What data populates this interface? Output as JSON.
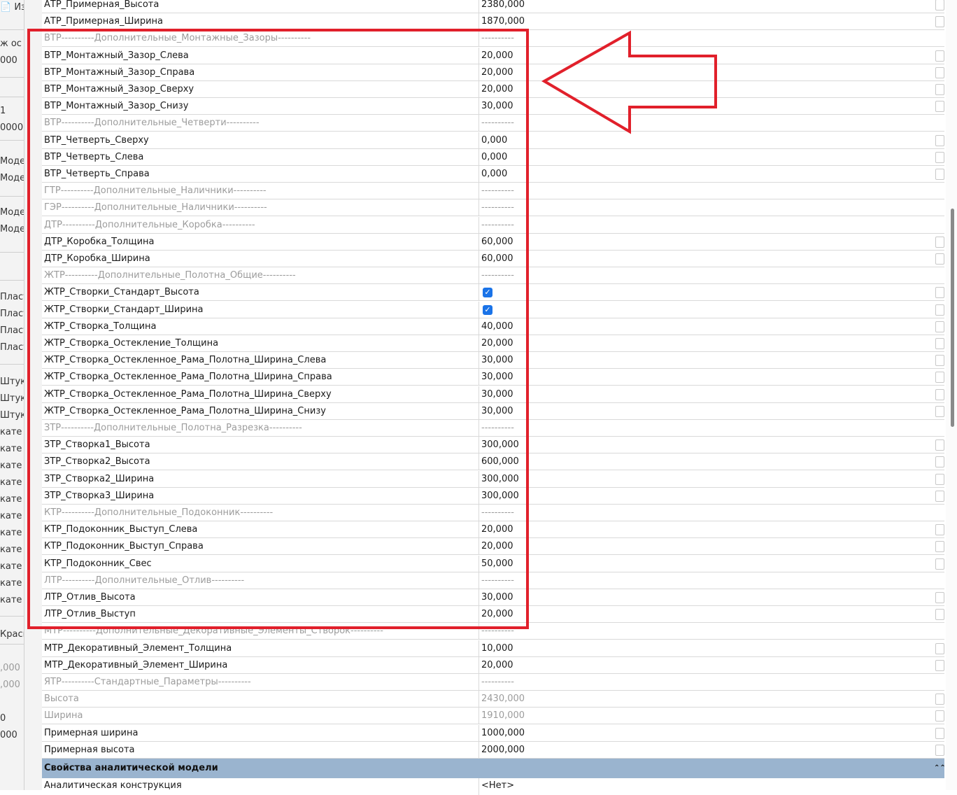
{
  "left_panel_fragments": [
    {
      "text": "📄 Из",
      "dim": false
    },
    {
      "text": "ж ос",
      "dim": false
    },
    {
      "text": "000",
      "dim": false
    },
    {
      "text": "1",
      "dim": false
    },
    {
      "text": "0000",
      "dim": false
    },
    {
      "text": "Моде",
      "dim": false
    },
    {
      "text": "Моде",
      "dim": false
    },
    {
      "text": "Моде",
      "dim": false
    },
    {
      "text": "Моде",
      "dim": false
    },
    {
      "text": "Пласт",
      "dim": false
    },
    {
      "text": "Пласт",
      "dim": false
    },
    {
      "text": "Пласт",
      "dim": false
    },
    {
      "text": "Пласт",
      "dim": false
    },
    {
      "text": "Штука",
      "dim": false
    },
    {
      "text": "Штука",
      "dim": false
    },
    {
      "text": "Штука",
      "dim": false
    },
    {
      "text": "кате",
      "dim": false
    },
    {
      "text": "кате",
      "dim": false
    },
    {
      "text": "кате",
      "dim": false
    },
    {
      "text": "кате",
      "dim": false
    },
    {
      "text": "кате",
      "dim": false
    },
    {
      "text": "кате",
      "dim": false
    },
    {
      "text": "кате",
      "dim": false
    },
    {
      "text": "кате",
      "dim": false
    },
    {
      "text": "кате",
      "dim": false
    },
    {
      "text": "кате",
      "dim": false
    },
    {
      "text": "кате",
      "dim": false
    },
    {
      "text": "Краск",
      "dim": false
    },
    {
      "text": ",000",
      "dim": true
    },
    {
      "text": ",000",
      "dim": true
    },
    {
      "text": "0",
      "dim": false
    },
    {
      "text": "000",
      "dim": false
    }
  ],
  "rows": [
    {
      "name": "АТР_Примерная_Высота",
      "value": "2380,000",
      "kind": "normal"
    },
    {
      "name": "АТР_Примерная_Ширина",
      "value": "1870,000",
      "kind": "normal"
    },
    {
      "name": "ВТР----------Дополнительные_Монтажные_Зазоры----------",
      "value": "----------",
      "kind": "group"
    },
    {
      "name": "ВТР_Монтажный_Зазор_Слева",
      "value": "20,000",
      "kind": "normal"
    },
    {
      "name": "ВТР_Монтажный_Зазор_Справа",
      "value": "20,000",
      "kind": "normal"
    },
    {
      "name": "ВТР_Монтажный_Зазор_Сверху",
      "value": "20,000",
      "kind": "normal"
    },
    {
      "name": "ВТР_Монтажный_Зазор_Снизу",
      "value": "30,000",
      "kind": "normal"
    },
    {
      "name": "ВТР----------Дополнительные_Четверти----------",
      "value": "----------",
      "kind": "group"
    },
    {
      "name": "ВТР_Четверть_Сверху",
      "value": "0,000",
      "kind": "normal"
    },
    {
      "name": "ВТР_Четверть_Слева",
      "value": "0,000",
      "kind": "normal"
    },
    {
      "name": "ВТР_Четверть_Справа",
      "value": "0,000",
      "kind": "normal"
    },
    {
      "name": "ГТР----------Дополнительные_Наличники----------",
      "value": "----------",
      "kind": "group"
    },
    {
      "name": "ГЭР----------Дополнительные_Наличники----------",
      "value": "----------",
      "kind": "group"
    },
    {
      "name": "ДТР----------Дополнительные_Коробка----------",
      "value": "----------",
      "kind": "group"
    },
    {
      "name": "ДТР_Коробка_Толщина",
      "value": "60,000",
      "kind": "normal"
    },
    {
      "name": "ДТР_Коробка_Ширина",
      "value": "60,000",
      "kind": "normal"
    },
    {
      "name": "ЖТР----------Дополнительные_Полотна_Общие----------",
      "value": "----------",
      "kind": "group"
    },
    {
      "name": "ЖТР_Створки_Стандарт_Высота",
      "value": "",
      "kind": "checkbox"
    },
    {
      "name": "ЖТР_Створки_Стандарт_Ширина",
      "value": "",
      "kind": "checkbox"
    },
    {
      "name": "ЖТР_Створка_Толщина",
      "value": "40,000",
      "kind": "normal"
    },
    {
      "name": "ЖТР_Створка_Остекление_Толщина",
      "value": "20,000",
      "kind": "normal"
    },
    {
      "name": "ЖТР_Створка_Остекленное_Рама_Полотна_Ширина_Слева",
      "value": "30,000",
      "kind": "normal"
    },
    {
      "name": "ЖТР_Створка_Остекленное_Рама_Полотна_Ширина_Справа",
      "value": "30,000",
      "kind": "normal"
    },
    {
      "name": "ЖТР_Створка_Остекленное_Рама_Полотна_Ширина_Сверху",
      "value": "30,000",
      "kind": "normal"
    },
    {
      "name": "ЖТР_Створка_Остекленное_Рама_Полотна_Ширина_Снизу",
      "value": "30,000",
      "kind": "normal"
    },
    {
      "name": "ЗТР----------Дополнительные_Полотна_Разрезка----------",
      "value": "----------",
      "kind": "group"
    },
    {
      "name": "ЗТР_Створка1_Высота",
      "value": "300,000",
      "kind": "normal"
    },
    {
      "name": "ЗТР_Створка2_Высота",
      "value": "600,000",
      "kind": "normal"
    },
    {
      "name": "ЗТР_Створка2_Ширина",
      "value": "300,000",
      "kind": "normal"
    },
    {
      "name": "ЗТР_Створка3_Ширина",
      "value": "300,000",
      "kind": "normal"
    },
    {
      "name": "КТР----------Дополнительные_Подоконник----------",
      "value": "----------",
      "kind": "group"
    },
    {
      "name": "КТР_Подоконник_Выступ_Слева",
      "value": "20,000",
      "kind": "normal"
    },
    {
      "name": "КТР_Подоконник_Выступ_Справа",
      "value": "20,000",
      "kind": "normal"
    },
    {
      "name": "КТР_Подоконник_Свес",
      "value": "50,000",
      "kind": "normal"
    },
    {
      "name": "ЛТР----------Дополнительные_Отлив----------",
      "value": "----------",
      "kind": "group"
    },
    {
      "name": "ЛТР_Отлив_Высота",
      "value": "30,000",
      "kind": "normal"
    },
    {
      "name": "ЛТР_Отлив_Выступ",
      "value": "20,000",
      "kind": "normal"
    },
    {
      "name": "МТР----------Дополнительные_Декоративные_Элементы_Створок----------",
      "value": "----------",
      "kind": "group"
    },
    {
      "name": "МТР_Декоративный_Элемент_Толщина",
      "value": "10,000",
      "kind": "normal"
    },
    {
      "name": "МТР_Декоративный_Элемент_Ширина",
      "value": "20,000",
      "kind": "normal"
    },
    {
      "name": "ЯТР----------Стандартные_Параметры----------",
      "value": "----------",
      "kind": "group"
    },
    {
      "name": "Высота",
      "value": "2430,000",
      "kind": "dim"
    },
    {
      "name": "Ширина",
      "value": "1910,000",
      "kind": "dim"
    },
    {
      "name": "Примерная ширина",
      "value": "1000,000",
      "kind": "normal"
    },
    {
      "name": "Примерная высота",
      "value": "2000,000",
      "kind": "normal"
    }
  ],
  "section": {
    "title": "Свойства аналитической модели",
    "chevron": "⌃⌃"
  },
  "last_row": {
    "name": "Аналитическая конструкция",
    "value": "<Нет>"
  },
  "annotation": {
    "box_color": "#e1202b",
    "arrow_color": "#e1202b"
  }
}
